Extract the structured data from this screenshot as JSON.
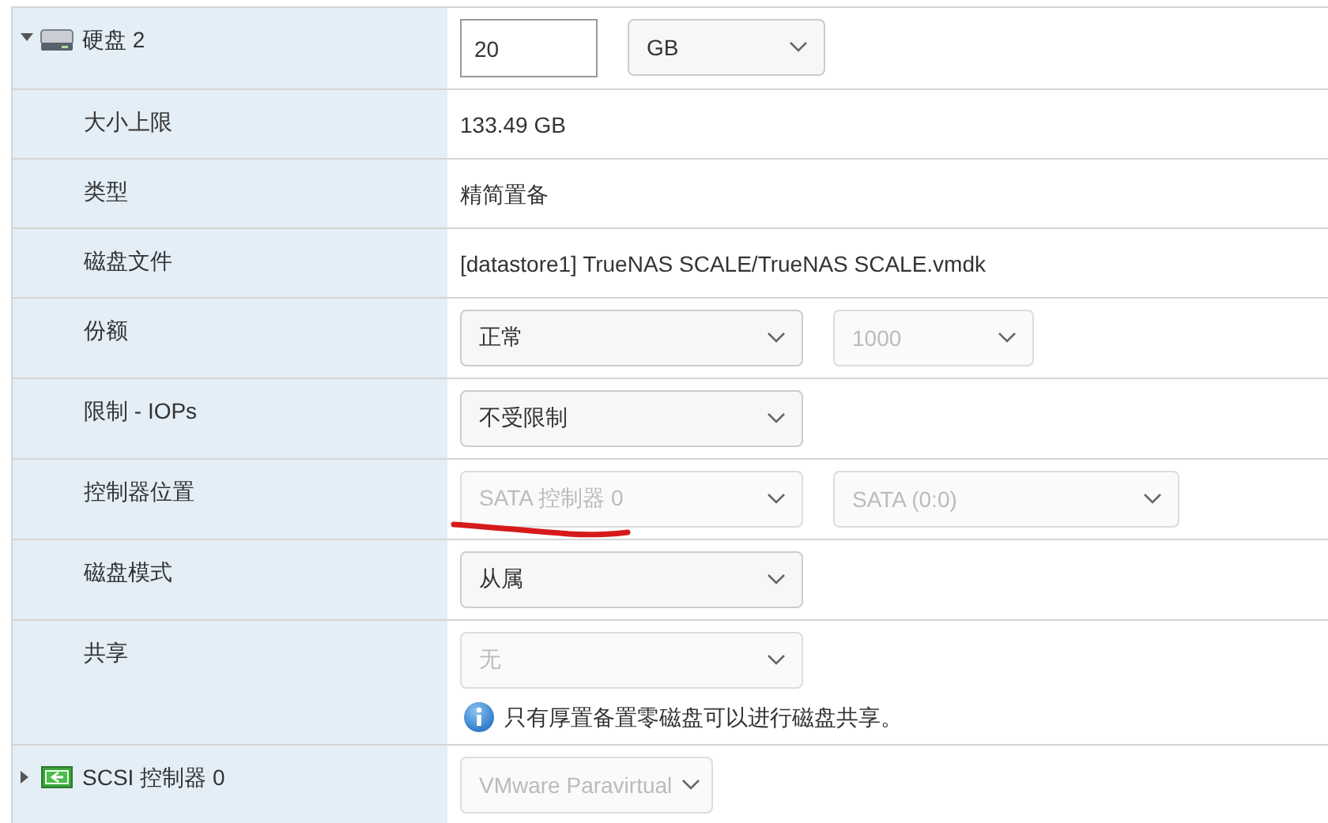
{
  "rows": [
    {
      "kind": "disk",
      "label": "硬盘 2",
      "expanded": true,
      "controls": [
        {
          "kind": "input",
          "value": "20"
        },
        {
          "kind": "select",
          "value": "GB",
          "disabled": false
        }
      ]
    },
    {
      "kind": "text",
      "label": "大小上限",
      "value": "133.49 GB"
    },
    {
      "kind": "text",
      "label": "类型",
      "value": "精简置备"
    },
    {
      "kind": "text",
      "label": "磁盘文件",
      "value": "[datastore1] TrueNAS SCALE/TrueNAS SCALE.vmdk"
    },
    {
      "kind": "field",
      "label": "份额",
      "controls": [
        {
          "kind": "select",
          "value": "正常",
          "disabled": false
        },
        {
          "kind": "select",
          "value": "1000",
          "disabled": true
        }
      ]
    },
    {
      "kind": "field",
      "label": "限制 - IOPs",
      "controls": [
        {
          "kind": "select",
          "value": "不受限制",
          "disabled": false
        }
      ]
    },
    {
      "kind": "field",
      "label": "控制器位置",
      "controls": [
        {
          "kind": "select",
          "value": "SATA 控制器 0",
          "disabled": true,
          "underlined": true
        },
        {
          "kind": "select",
          "value": "SATA (0:0)",
          "disabled": true
        }
      ]
    },
    {
      "kind": "field",
      "label": "磁盘模式",
      "controls": [
        {
          "kind": "select",
          "value": "从属",
          "disabled": false
        }
      ]
    },
    {
      "kind": "field",
      "label": "共享",
      "controls": [
        {
          "kind": "select",
          "value": "无",
          "disabled": true
        }
      ],
      "note": "只有厚置备置零磁盘可以进行磁盘共享。"
    },
    {
      "kind": "controller",
      "label": "SCSI 控制器 0",
      "expanded": false,
      "controls": [
        {
          "kind": "select",
          "value": "VMware Paravirtual",
          "disabled": true
        }
      ]
    }
  ]
}
